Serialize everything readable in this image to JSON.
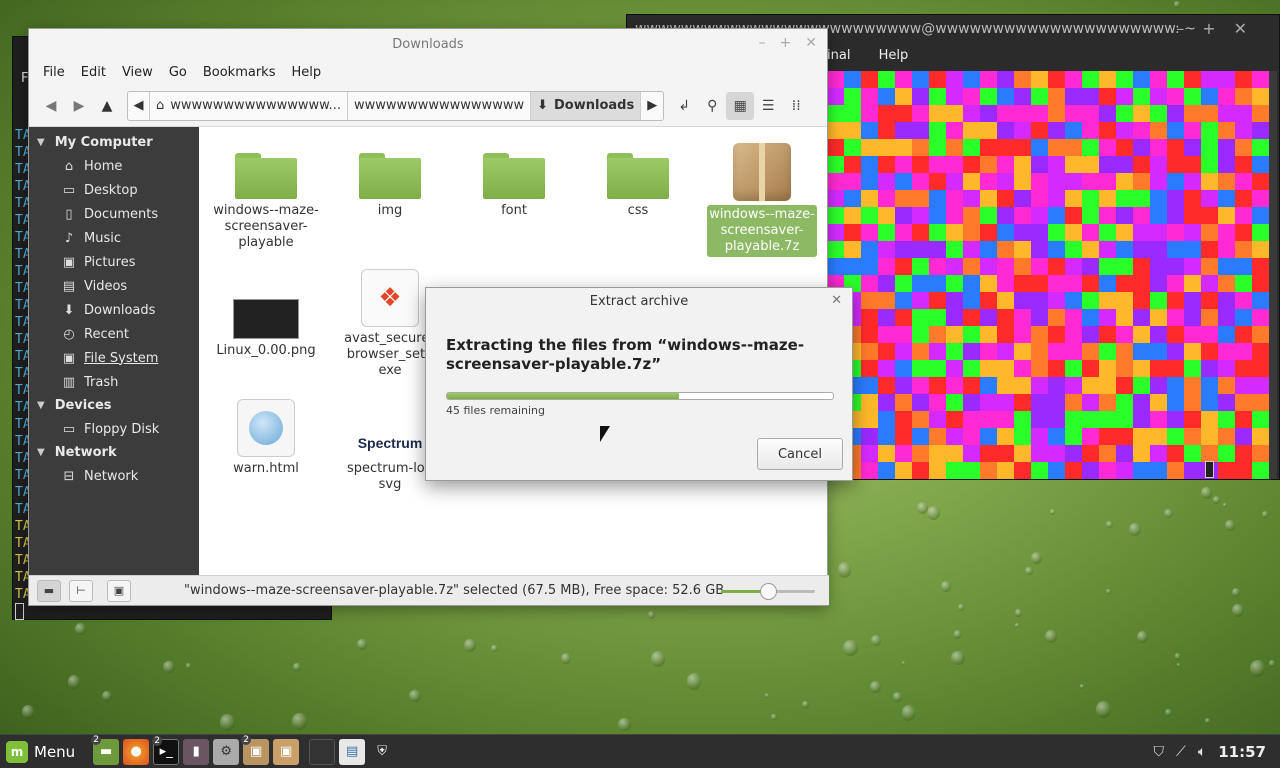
{
  "file_manager": {
    "title": "Downloads",
    "menus": [
      "File",
      "Edit",
      "View",
      "Go",
      "Bookmarks",
      "Help"
    ],
    "path_segments": [
      "wwwwwwwwwwwwwww...",
      "wwwwwwwwwwwwwwww"
    ],
    "current_folder": "Downloads",
    "sidebar": {
      "my_computer": "My Computer",
      "items": [
        {
          "label": "Home",
          "icon": "home-icon"
        },
        {
          "label": "Desktop",
          "icon": "desktop-icon"
        },
        {
          "label": "Documents",
          "icon": "documents-icon"
        },
        {
          "label": "Music",
          "icon": "music-icon"
        },
        {
          "label": "Pictures",
          "icon": "pictures-icon"
        },
        {
          "label": "Videos",
          "icon": "videos-icon"
        },
        {
          "label": "Downloads",
          "icon": "downloads-icon"
        },
        {
          "label": "Recent",
          "icon": "recent-icon"
        },
        {
          "label": "File System",
          "icon": "filesystem-icon"
        },
        {
          "label": "Trash",
          "icon": "trash-icon"
        }
      ],
      "devices": "Devices",
      "devices_items": [
        {
          "label": "Floppy Disk",
          "icon": "floppy-icon"
        }
      ],
      "network": "Network",
      "network_items": [
        {
          "label": "Network",
          "icon": "network-icon"
        }
      ]
    },
    "files": [
      {
        "name": "windows--maze-\nscreensaver-\nplayable",
        "type": "folder"
      },
      {
        "name": "img",
        "type": "folder"
      },
      {
        "name": "font",
        "type": "folder"
      },
      {
        "name": "css",
        "type": "folder"
      },
      {
        "name": "windows--maze-\nscreensaver-\nplayable.7z",
        "type": "archive",
        "selected": true
      },
      {
        "name": "Linux_0.00.png",
        "type": "image"
      },
      {
        "name": "avast_secure_\nbrowser_setu\nexe",
        "type": "exe"
      },
      {
        "name": "warn.html",
        "type": "html"
      },
      {
        "name": "spectrum-log\nsvg",
        "type": "svg"
      }
    ],
    "status_text": "\"windows--maze-screensaver-playable.7z\" selected (67.5 MB), Free space: 52.6 GB",
    "zoom_level": 0.5
  },
  "dialog": {
    "title": "Extract archive",
    "heading": "Extracting the files from “windows--maze-screensaver-playable.7z”",
    "progress": 0.6,
    "remaining": "45 files remaining",
    "cancel_label": "Cancel"
  },
  "terminal_right": {
    "title": "wwwwwwwwwwwwwwwwwwwwwwwww@wwwwwwwwwwwwwwwwwwwww: ~",
    "menus": [
      "inal",
      "Help"
    ]
  },
  "terminal_left": {
    "menu_fragment": "F",
    "line_prefix": "TA"
  },
  "taskbar": {
    "menu_label": "Menu",
    "clock": "11:57",
    "badges": {
      "files": "2",
      "terminal": "2",
      "package": "2"
    }
  },
  "colors": {
    "accent_green": "#8db864",
    "mosaic_palette": [
      "#ff2a2a",
      "#2aff2a",
      "#9a2aff",
      "#ff2ad4",
      "#2a7bff",
      "#ffb82a",
      "#ff7a2a",
      "#d42aff"
    ]
  }
}
